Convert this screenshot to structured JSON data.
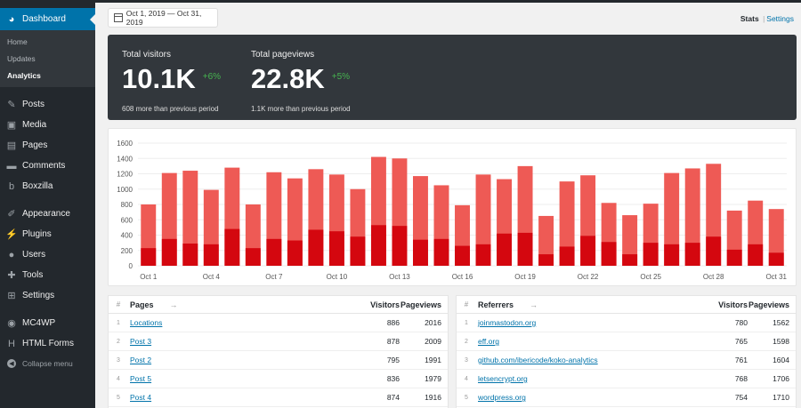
{
  "sidebar": {
    "dashboard": "Dashboard",
    "sub": [
      "Home",
      "Updates",
      "Analytics"
    ],
    "items": [
      {
        "label": "Posts",
        "icon": "pin-icon"
      },
      {
        "label": "Media",
        "icon": "media-icon"
      },
      {
        "label": "Pages",
        "icon": "pages-icon"
      },
      {
        "label": "Comments",
        "icon": "comments-icon"
      },
      {
        "label": "Boxzilla",
        "icon": "boxzilla-icon"
      },
      {
        "label": "Appearance",
        "icon": "brush-icon"
      },
      {
        "label": "Plugins",
        "icon": "plugin-icon"
      },
      {
        "label": "Users",
        "icon": "users-icon"
      },
      {
        "label": "Tools",
        "icon": "tools-icon"
      },
      {
        "label": "Settings",
        "icon": "settings-icon"
      },
      {
        "label": "MC4WP",
        "icon": "mc4wp-icon"
      },
      {
        "label": "HTML Forms",
        "icon": "forms-icon"
      }
    ],
    "collapse": "Collapse menu"
  },
  "date_range": "Oct 1, 2019 — Oct 31, 2019",
  "nav": {
    "stats": "Stats",
    "sep": "|",
    "settings": "Settings"
  },
  "totals": {
    "visitors": {
      "label": "Total visitors",
      "value": "10.1K",
      "delta": "+6%",
      "sub": "608 more than previous period"
    },
    "pageviews": {
      "label": "Total pageviews",
      "value": "22.8K",
      "delta": "+5%",
      "sub": "1.1K more than previous period"
    }
  },
  "colors": {
    "pageviews": "#ee5a55",
    "visitors": "#d4070f",
    "accent": "#0073aa",
    "positive": "#46b450"
  },
  "chart_data": {
    "type": "bar",
    "stacked": true,
    "y_ticks": [
      0,
      200,
      400,
      600,
      800,
      1000,
      1200,
      1400,
      1600
    ],
    "ylim": [
      0,
      1600
    ],
    "x_tick_labels": [
      "Oct 1",
      "Oct 4",
      "Oct 7",
      "Oct 10",
      "Oct 13",
      "Oct 16",
      "Oct 19",
      "Oct 22",
      "Oct 25",
      "Oct 28",
      "Oct 31"
    ],
    "categories": [
      "Oct 1",
      "Oct 2",
      "Oct 3",
      "Oct 4",
      "Oct 5",
      "Oct 6",
      "Oct 7",
      "Oct 8",
      "Oct 9",
      "Oct 10",
      "Oct 11",
      "Oct 12",
      "Oct 13",
      "Oct 14",
      "Oct 15",
      "Oct 16",
      "Oct 17",
      "Oct 18",
      "Oct 19",
      "Oct 20",
      "Oct 21",
      "Oct 22",
      "Oct 23",
      "Oct 24",
      "Oct 25",
      "Oct 26",
      "Oct 27",
      "Oct 28",
      "Oct 29",
      "Oct 30",
      "Oct 31"
    ],
    "series": [
      {
        "values": [
          800,
          1210,
          1240,
          990,
          1280,
          800,
          1220,
          1140,
          1260,
          1190,
          1000,
          1420,
          1400,
          1170,
          1050,
          790,
          1190,
          1130,
          1300,
          650,
          1100,
          1180,
          820,
          660,
          810,
          1210,
          1270,
          1330,
          720,
          850,
          740
        ]
      },
      {
        "values": [
          230,
          350,
          290,
          280,
          480,
          230,
          350,
          330,
          470,
          450,
          380,
          530,
          520,
          340,
          350,
          260,
          280,
          420,
          430,
          150,
          250,
          390,
          310,
          150,
          300,
          280,
          300,
          380,
          210,
          280,
          170
        ]
      }
    ]
  },
  "pages": {
    "headers": {
      "num": "#",
      "name": "Pages",
      "visitors": "Visitors",
      "pageviews": "Pageviews"
    },
    "rows": [
      {
        "num": "1",
        "name": "Locations",
        "visitors": "886",
        "pageviews": "2016"
      },
      {
        "num": "2",
        "name": "Post 3",
        "visitors": "878",
        "pageviews": "2009"
      },
      {
        "num": "3",
        "name": "Post 2",
        "visitors": "795",
        "pageviews": "1991"
      },
      {
        "num": "4",
        "name": "Post 5",
        "visitors": "836",
        "pageviews": "1979"
      },
      {
        "num": "5",
        "name": "Post 4",
        "visitors": "874",
        "pageviews": "1916"
      }
    ]
  },
  "referrers": {
    "headers": {
      "num": "#",
      "name": "Referrers",
      "visitors": "Visitors",
      "pageviews": "Pageviews"
    },
    "rows": [
      {
        "num": "1",
        "name": "joinmastodon.org",
        "visitors": "780",
        "pageviews": "1562"
      },
      {
        "num": "2",
        "name": "eff.org",
        "visitors": "765",
        "pageviews": "1598"
      },
      {
        "num": "3",
        "name": "github.com/ibericode/koko-analytics",
        "visitors": "761",
        "pageviews": "1604"
      },
      {
        "num": "4",
        "name": "letsencrypt.org",
        "visitors": "768",
        "pageviews": "1706"
      },
      {
        "num": "5",
        "name": "wordpress.org",
        "visitors": "754",
        "pageviews": "1710"
      }
    ]
  }
}
